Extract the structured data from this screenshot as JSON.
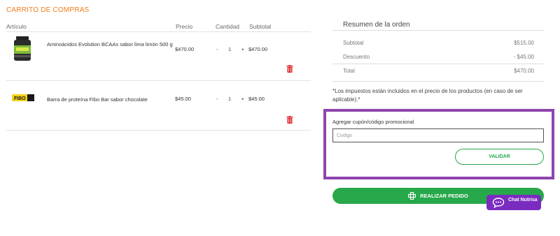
{
  "cart": {
    "title": "CARRITO DE COMPRAS"
  },
  "columns": {
    "article": "Artículo",
    "price": "Precio",
    "quantity": "Cantidad",
    "subtotal": "Subtotal"
  },
  "items": [
    {
      "name": "Aminoácidos Evolution BCAAs sabor lima limón 500 g",
      "price": "$470.00",
      "qty_minus": "-",
      "qty": "1",
      "qty_plus": "+",
      "subtotal": "$470.00",
      "image": "bcaa-jar-image",
      "delete_icon": "trash-icon"
    },
    {
      "name": "Barra de proteína Fibo Bar sabor chocolate",
      "price": "$45.00",
      "qty_minus": "-",
      "qty": "1",
      "qty_plus": "+",
      "subtotal": "$45.00",
      "image": "protein-bar-image",
      "image_text": "FIBO",
      "delete_icon": "trash-icon"
    }
  ],
  "summary": {
    "title": "Resumen de la orden",
    "subtotal_label": "Subtotal",
    "subtotal_value": "$515.00",
    "discount_label": "Descuento",
    "discount_value": "- $45.00",
    "total_label": "Total",
    "total_value": "$470.00",
    "tax_note": "*Los impuestos están incluidos en el precio de los productos (en caso de ser aplicable).*"
  },
  "coupon": {
    "label": "Agregar cupón/código promocional",
    "placeholder": "Codigo",
    "value": "",
    "button": "VALIDAR",
    "highlight_color": "#8e44ad"
  },
  "order": {
    "button": "REALIZAR PEDIDO",
    "icon": "pharmacy-cross-icon"
  },
  "chat": {
    "label": "Chat Nutrisa",
    "icon": "chat-bubble-icon"
  },
  "colors": {
    "accent": "#f07d1a",
    "primary_green": "#27a84a",
    "delete_red": "#e0262b",
    "chat_purple": "#7b2cc0"
  }
}
